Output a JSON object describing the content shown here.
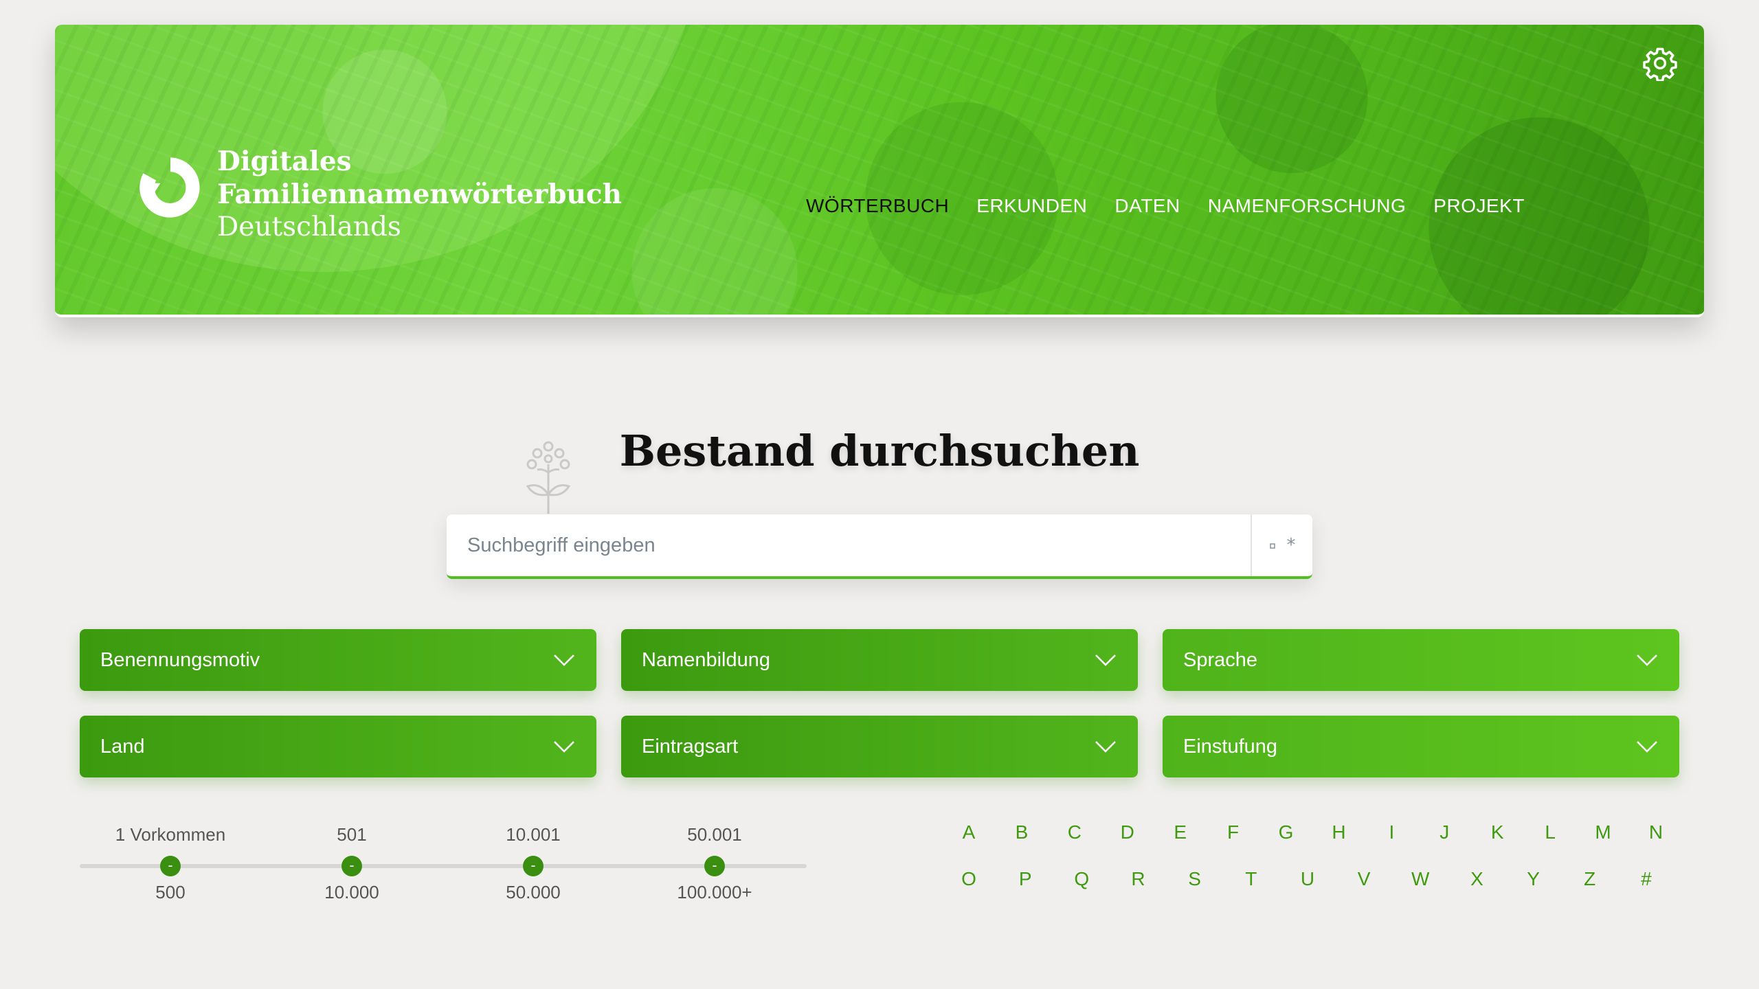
{
  "logo": {
    "line1": "Digitales",
    "line2": "Familiennamenwörterbuch",
    "line3": "Deutschlands"
  },
  "nav": {
    "items": [
      "WÖRTERBUCH",
      "ERKUNDEN",
      "DATEN",
      "NAMENFORSCHUNG",
      "PROJEKT"
    ],
    "active": "WÖRTERBUCH"
  },
  "settings_icon": "gear-icon",
  "main": {
    "title": "Bestand durchsuchen",
    "search_placeholder": "Suchbegriff eingeben",
    "wildcard_label": "*"
  },
  "filters": [
    "Benennungsmotiv",
    "Namenbildung",
    "Sprache",
    "Land",
    "Eintragsart",
    "Einstufung"
  ],
  "frequency": {
    "top_labels": [
      "1 Vorkommen",
      "501",
      "10.001",
      "50.001"
    ],
    "bottom_labels": [
      "500",
      "10.000",
      "50.000",
      "100.000+"
    ],
    "handle_label": "-"
  },
  "alphabet": {
    "row1": [
      "A",
      "B",
      "C",
      "D",
      "E",
      "F",
      "G",
      "H",
      "I",
      "J",
      "K",
      "L",
      "M",
      "N"
    ],
    "row2": [
      "O",
      "P",
      "Q",
      "R",
      "S",
      "T",
      "U",
      "V",
      "W",
      "X",
      "Y",
      "Z",
      "#"
    ]
  },
  "colors": {
    "accent": "#4fbf1e",
    "dark_green": "#3a8f10",
    "background": "#f1efee"
  }
}
